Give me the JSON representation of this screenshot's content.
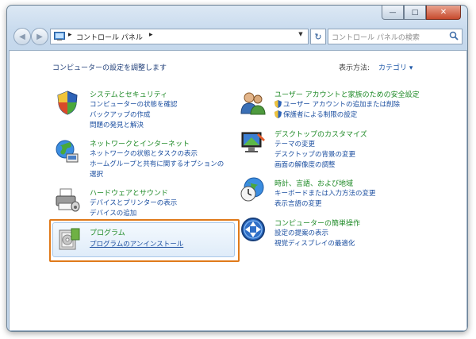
{
  "window": {
    "caption_buttons": {
      "minimize": "—",
      "maximize": "□",
      "close": "✕"
    }
  },
  "navbar": {
    "back_glyph": "◀",
    "forward_glyph": "▶",
    "breadcrumb_root": "コントロール パネル",
    "separator": "▸",
    "dropdown_glyph": "▼",
    "refresh_glyph": "↻",
    "search_placeholder": "コントロール パネルの検索"
  },
  "header": {
    "heading": "コンピューターの設定を調整します",
    "view_label": "表示方法:",
    "view_value": "カテゴリ ▾"
  },
  "categories": {
    "system": {
      "title": "システムとセキュリティ",
      "links": [
        "コンピューターの状態を確認",
        "バックアップの作成",
        "問題の発見と解決"
      ],
      "icon": "shield-icon"
    },
    "network": {
      "title": "ネットワークとインターネット",
      "links": [
        "ネットワークの状態とタスクの表示",
        "ホームグループと共有に関するオプションの",
        "選択"
      ],
      "icon": "globe-network-icon"
    },
    "hardware": {
      "title": "ハードウェアとサウンド",
      "links": [
        "デバイスとプリンターの表示",
        "デバイスの追加"
      ],
      "icon": "printer-icon"
    },
    "programs": {
      "title": "プログラム",
      "links": [
        "プログラムのアンインストール"
      ],
      "icon": "programs-icon"
    },
    "users": {
      "title": "ユーザー アカウントと家族のための安全設定",
      "links": [
        "ユーザー アカウントの追加または削除",
        "保護者による制限の設定"
      ],
      "icon": "users-icon"
    },
    "appearance": {
      "title": "デスクトップのカスタマイズ",
      "links": [
        "テーマの変更",
        "デスクトップの背景の変更",
        "画面の解像度の調整"
      ],
      "icon": "desktop-icon"
    },
    "clock": {
      "title": "時計、言語、および地域",
      "links": [
        "キーボードまたは入力方法の変更",
        "表示言語の変更"
      ],
      "icon": "clock-globe-icon"
    },
    "ease": {
      "title": "コンピューターの簡単操作",
      "links": [
        "設定の提案の表示",
        "視覚ディスプレイの最適化"
      ],
      "icon": "ease-of-access-icon"
    }
  },
  "colors": {
    "title_green": "#1e8a26",
    "link_blue": "#1c4fa0",
    "highlight_border": "#e07a1a"
  }
}
